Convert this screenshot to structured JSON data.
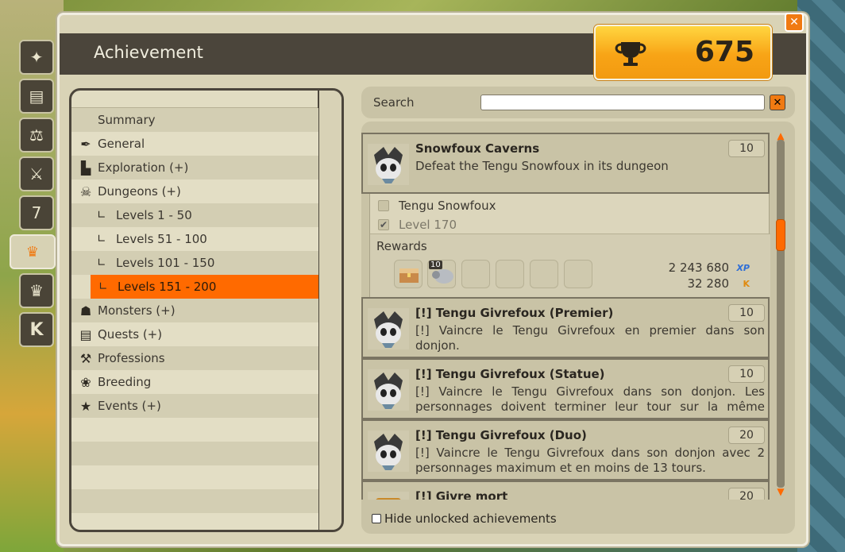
{
  "window": {
    "title": "Achievement",
    "points": "675",
    "close_label": "✕"
  },
  "side_tabs": [
    {
      "icon": "spell-icon",
      "glyph": "✦"
    },
    {
      "icon": "book-icon",
      "glyph": "▤"
    },
    {
      "icon": "scales-icon",
      "glyph": "⚖"
    },
    {
      "icon": "crossed-axes-icon",
      "glyph": "⚔"
    },
    {
      "icon": "calendar-icon",
      "glyph": "7"
    },
    {
      "icon": "trophy-icon",
      "glyph": "🏆"
    },
    {
      "icon": "crown-icon",
      "glyph": "♛"
    },
    {
      "icon": "k-icon",
      "glyph": "K"
    }
  ],
  "categories": [
    {
      "label": "Summary",
      "icon": "none",
      "glyph": ""
    },
    {
      "label": "General",
      "icon": "quill-icon",
      "glyph": "✒"
    },
    {
      "label": "Exploration (+)",
      "icon": "boot-icon",
      "glyph": "▙"
    },
    {
      "label": "Dungeons (+)",
      "icon": "skull-horns-icon",
      "glyph": "☠"
    },
    {
      "label": "Levels 1 - 50",
      "icon": "subitem-icon",
      "glyph": "∟",
      "sub": true
    },
    {
      "label": "Levels 51 - 100",
      "icon": "subitem-icon",
      "glyph": "∟",
      "sub": true
    },
    {
      "label": "Levels 101 - 150",
      "icon": "subitem-icon",
      "glyph": "∟",
      "sub": true
    },
    {
      "label": "Levels 151 - 200",
      "icon": "subitem-icon",
      "glyph": "∟",
      "sub": true,
      "selected": true
    },
    {
      "label": "Monsters (+)",
      "icon": "monster-icon",
      "glyph": "☗"
    },
    {
      "label": "Quests (+)",
      "icon": "scroll-icon",
      "glyph": "▤"
    },
    {
      "label": "Professions",
      "icon": "hammer-icon",
      "glyph": "⚒"
    },
    {
      "label": "Breeding",
      "icon": "paw-icon",
      "glyph": "❀"
    },
    {
      "label": "Events (+)",
      "icon": "star-icon",
      "glyph": "★"
    }
  ],
  "search": {
    "label": "Search",
    "value": "",
    "placeholder": "",
    "clear_label": "✕"
  },
  "achievements": [
    {
      "name": "Snowfoux Caverns",
      "description": "Defeat the Tengu Snowfoux in its dungeon",
      "points": "10",
      "expanded": true,
      "objectives": [
        {
          "label": "Tengu Snowfoux",
          "done": false
        },
        {
          "label": "Level 170",
          "done": true
        }
      ],
      "rewards_label": "Rewards",
      "reward_item_count": "10",
      "xp": "2 243 680",
      "xp_tag": "XP",
      "kamas": "32 280",
      "kamas_tag": "K"
    },
    {
      "name": "[!] Tengu Givrefoux (Premier)",
      "description": "[!] Vaincre le Tengu Givrefoux en premier dans son donjon.",
      "points": "10"
    },
    {
      "name": "[!] Tengu Givrefoux (Statue)",
      "description": "[!] Vaincre le Tengu Givrefoux dans son donjon. Les personnages doivent terminer leur tour sur la même case…",
      "points": "10"
    },
    {
      "name": "[!] Tengu Givrefoux (Duo)",
      "description": "[!] Vaincre le Tengu Givrefoux dans son donjon avec 2 personnages maximum et en moins de 13 tours.",
      "points": "20"
    },
    {
      "name": "[!] Givre mort",
      "description": "",
      "points": "20"
    }
  ],
  "list_scroll_fraction": 0.25,
  "hide_unlocked": {
    "label": "Hide unlocked achievements",
    "checked": false
  },
  "colors": {
    "accent": "#ff6a00",
    "header": "#4b453b",
    "panel": "#d9d3b6",
    "points_gold": "#f8a416"
  }
}
